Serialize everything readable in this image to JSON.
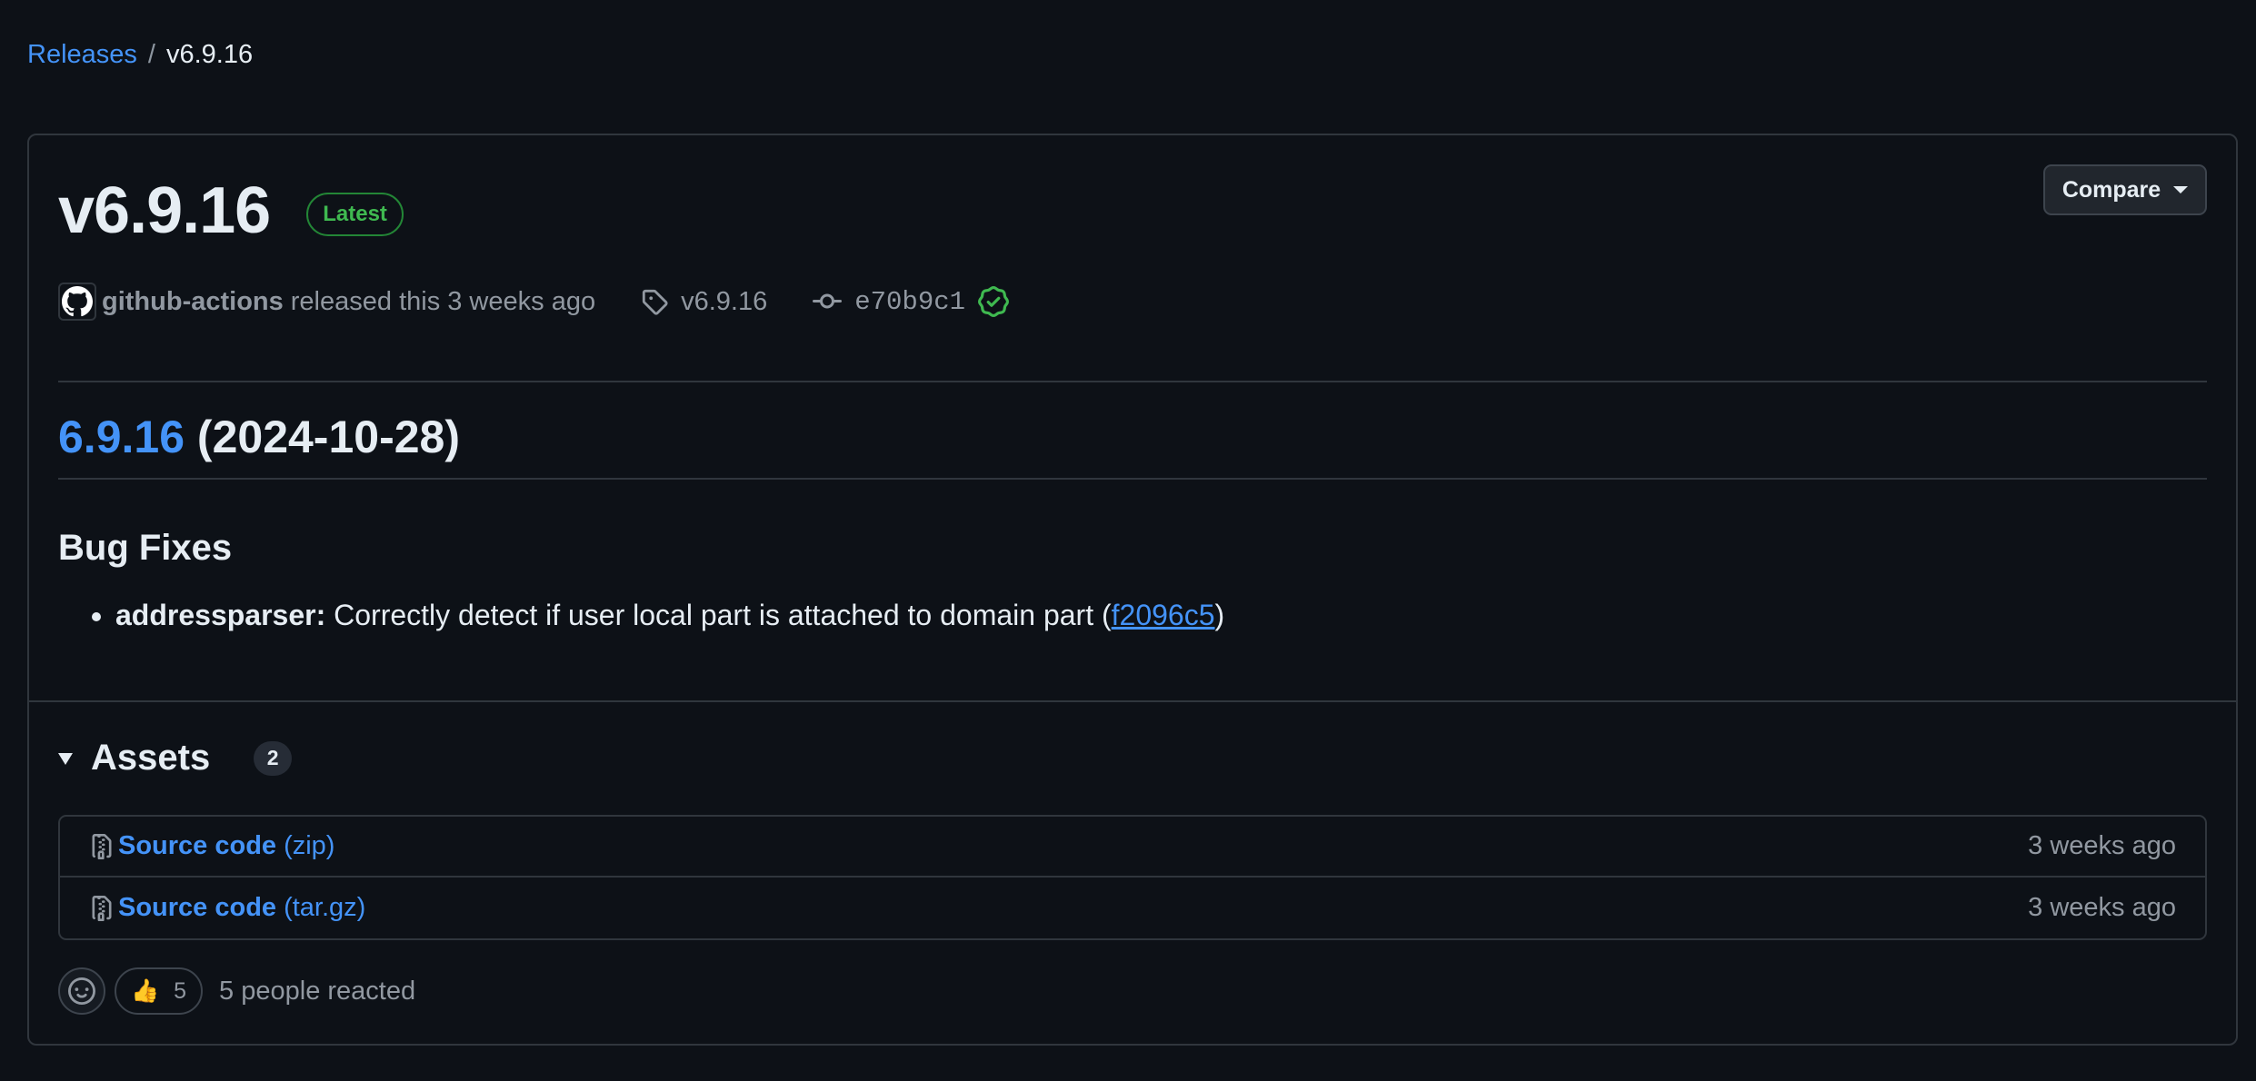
{
  "breadcrumb": {
    "parent": "Releases",
    "separator": "/",
    "current": "v6.9.16"
  },
  "release": {
    "title": "v6.9.16",
    "badge": "Latest",
    "compare_label": "Compare",
    "author": "github-actions",
    "released_text": "released this 3 weeks ago",
    "tag": "v6.9.16",
    "commit": "e70b9c1",
    "commit_verified": true
  },
  "notes": {
    "version_link": "6.9.16",
    "version_date": "(2024-10-28)",
    "section_title": "Bug Fixes",
    "items": [
      {
        "scope": "addressparser:",
        "text": "Correctly detect if user local part is attached to domain part (",
        "commit_link": "f2096c5",
        "suffix": ")"
      }
    ]
  },
  "assets": {
    "title": "Assets",
    "count": "2",
    "items": [
      {
        "name": "Source code",
        "ext": "(zip)",
        "time": "3 weeks ago"
      },
      {
        "name": "Source code",
        "ext": "(tar.gz)",
        "time": "3 weeks ago"
      }
    ]
  },
  "reactions": {
    "thumbs_up_emoji": "👍",
    "thumbs_up_count": "5",
    "summary": "5 people reacted"
  },
  "colors": {
    "background": "#0d1117",
    "link": "#4493f8",
    "success": "#3fb950",
    "border": "#30363d",
    "muted": "#9198a1"
  },
  "icons": [
    "github-mark-icon",
    "tag-icon",
    "git-commit-icon",
    "verified-icon",
    "file-zip-icon",
    "smiley-icon",
    "triangle-down-icon",
    "caret-down-icon"
  ]
}
